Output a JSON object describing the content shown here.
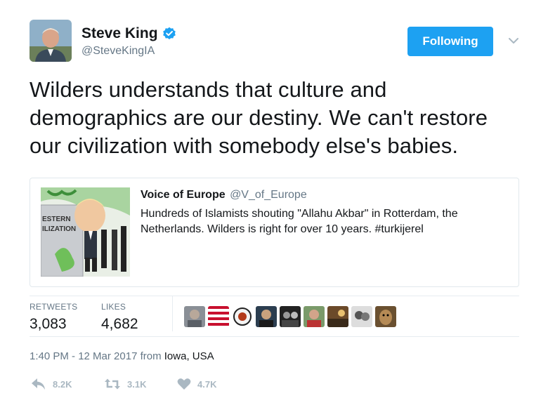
{
  "author": {
    "name": "Steve King",
    "handle": "@SteveKingIA"
  },
  "follow_button_label": "Following",
  "tweet": {
    "text": "Wilders understands that culture and demographics are our destiny. We can't restore our civilization with somebody else's babies."
  },
  "quoted": {
    "name": "Voice of Europe",
    "handle": "@V_of_Europe",
    "text": "Hundreds of Islamists shouting \"Allahu Akbar\" in Rotterdam, the Netherlands. Wilders is right for over 10 years. #turkijerel",
    "image_text_1": "ESTERN",
    "image_text_2": "ILIZATION"
  },
  "stats": {
    "retweets_label": "RETWEETS",
    "retweets_value": "3,083",
    "likes_label": "LIKES",
    "likes_value": "4,682"
  },
  "timestamp": {
    "time": "1:40 PM - 12 Mar 2017",
    "from": "from",
    "location": "Iowa, USA"
  },
  "actions": {
    "reply_count": "8.2K",
    "retweet_count": "3.1K",
    "like_count": "4.7K"
  },
  "colors": {
    "brand_blue": "#1da1f2",
    "muted": "#657786",
    "icon_muted": "#aab8c2"
  },
  "icons": [
    "verified-badge-icon",
    "chevron-down-icon",
    "reply-icon",
    "retweet-icon",
    "heart-icon"
  ]
}
